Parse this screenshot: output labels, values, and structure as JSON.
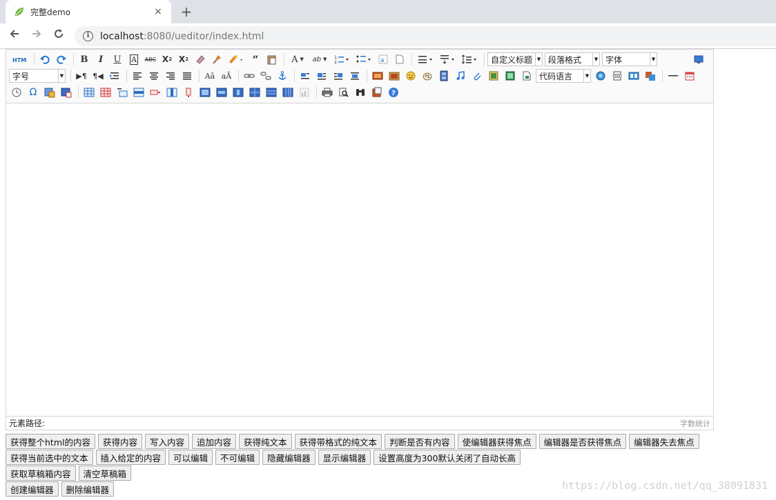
{
  "browser": {
    "tab_title": "完整demo",
    "close_glyph": "×",
    "newtab_glyph": "+",
    "url_host": "localhost",
    "url_rest": ":8080/ueditor/index.html"
  },
  "editor": {
    "toolbar": {
      "row1": [
        "html",
        "undo",
        "redo",
        "bold",
        "italic",
        "underline",
        "fontborder",
        "strikethrough",
        "superscript",
        "subscript",
        "removeformat",
        "formatmatch",
        "autotypeset",
        "blockquote",
        "pasteplain",
        "forecolor",
        "backcolor",
        "insertorderedlist",
        "insertunorderedlist",
        "selectall",
        "cleardoc",
        "rowspacingtop",
        "rowspacingbottom",
        "lineheight",
        "customstyle",
        "paragraph",
        "fontfamily",
        "fontsize",
        "fullscreen"
      ],
      "combos": {
        "customstyle": "自定义标题",
        "paragraph": "段落格式",
        "fontfamily": "字体",
        "fontsize": "字号",
        "insertcode": "代码语言"
      }
    },
    "statusbar": {
      "path_label": "元素路径:",
      "wordcount_label": "字数统计"
    }
  },
  "buttons": {
    "row1": [
      "获得整个html的内容",
      "获得内容",
      "写入内容",
      "追加内容",
      "获得纯文本",
      "获得带格式的纯文本",
      "判断是否有内容",
      "使编辑器获得焦点",
      "编辑器是否获得焦点",
      "编辑器失去焦点"
    ],
    "row2": [
      "获得当前选中的文本",
      "插入给定的内容",
      "可以编辑",
      "不可编辑",
      "隐藏编辑器",
      "显示编辑器",
      "设置高度为300默认关闭了自动长高"
    ],
    "row3": [
      "获取草稿箱内容",
      "清空草稿箱"
    ],
    "row4": [
      "创建编辑器",
      "删除编辑器"
    ]
  },
  "watermark": "https://blog.csdn.net/qq_38091831",
  "colors": {
    "accent": "#1a73e8",
    "toolbar_bg": "#fafafa",
    "button_bg": "#efefef"
  }
}
